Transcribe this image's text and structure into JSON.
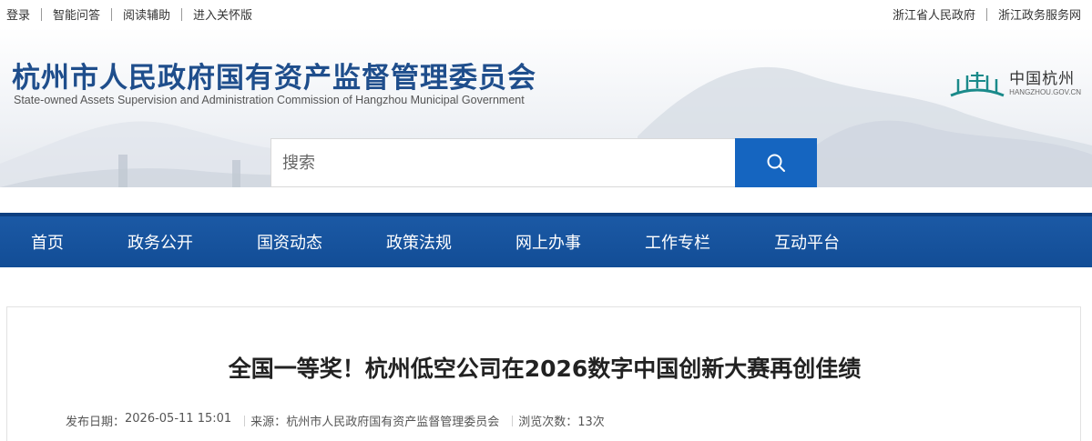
{
  "topbar": {
    "left_links": [
      "登录",
      "智能问答",
      "阅读辅助",
      "进入关怀版"
    ],
    "right_links": [
      "浙江省人民政府",
      "浙江政务服务网"
    ]
  },
  "header": {
    "title": "杭州市人民政府国有资产监督管理委员会",
    "subtitle": "State-owned  Assets Supervision and Administration Commission of Hangzhou Municipal  Government",
    "logo": {
      "cn": "中国杭州",
      "en": "HANGZHOU.GOV.CN",
      "icon": "hangzhou-landmark-icon"
    }
  },
  "search": {
    "placeholder": "搜索",
    "button_icon": "search-icon"
  },
  "nav": {
    "items": [
      "首页",
      "政务公开",
      "国资动态",
      "政策法规",
      "网上办事",
      "工作专栏",
      "互动平台"
    ]
  },
  "article": {
    "title": "全国一等奖！杭州低空公司在2026数字中国创新大赛再创佳绩",
    "publish_label": "发布日期：",
    "publish_value": "2026-05-11 15:01",
    "source_label": "来源：",
    "source_value": "杭州市人民政府国有资产监督管理委员会",
    "views_label": "浏览次数：",
    "views_value": "13次"
  },
  "colors": {
    "brand_blue": "#1f4e8c",
    "nav_blue": "#1a58a3",
    "search_blue": "#1565c0",
    "logo_teal": "#1a8a8a"
  }
}
